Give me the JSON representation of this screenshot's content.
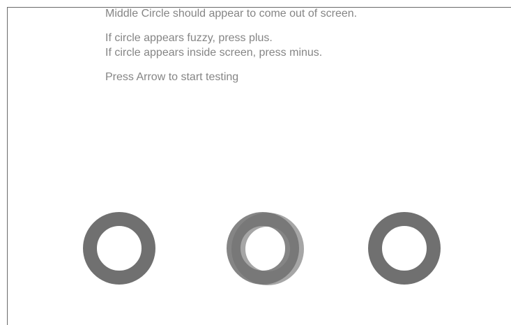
{
  "instructions": {
    "line1": "Middle Circle should appear to come out of screen.",
    "line2": "If circle appears fuzzy, press plus.",
    "line3": "If circle appears inside screen, press minus.",
    "line4": "Press Arrow to start testing"
  },
  "colors": {
    "text": "#858585",
    "ring": "#707070",
    "ring_ghost": "#a6a6a6",
    "frame": "#6a6a6a"
  },
  "icons": [
    "left-ring-icon",
    "middle-ring-icon",
    "right-ring-icon"
  ]
}
